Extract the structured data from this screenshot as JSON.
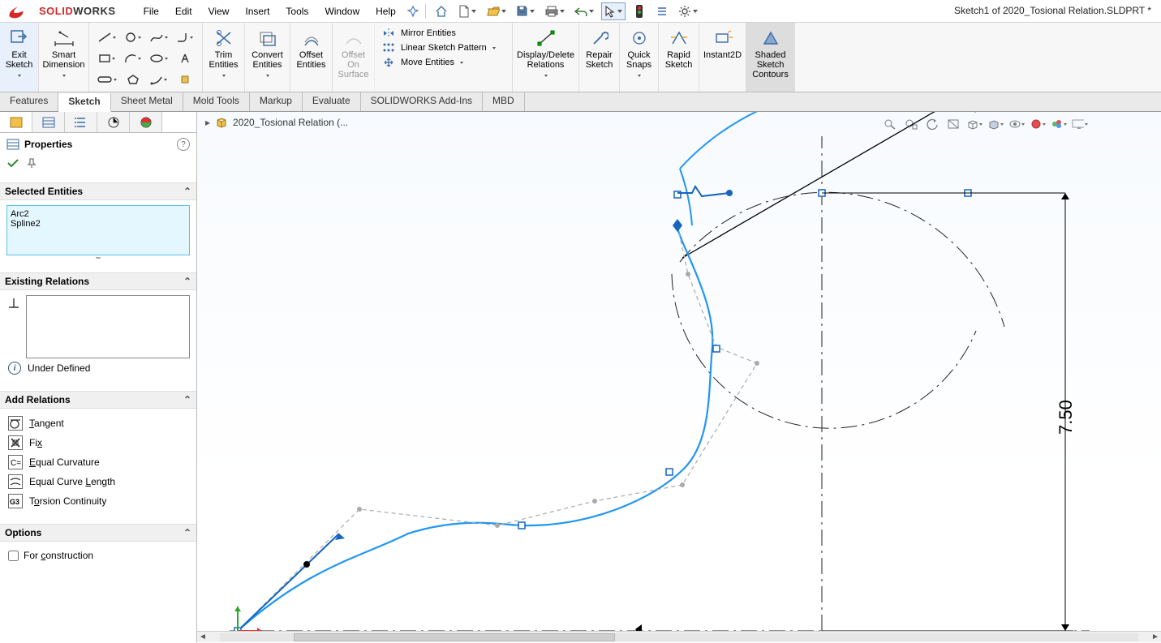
{
  "brand": {
    "s1": "SOLID",
    "s2": "WORKS"
  },
  "doc_title": "Sketch1 of 2020_Tosional Relation.SLDPRT *",
  "menu": [
    "File",
    "Edit",
    "View",
    "Insert",
    "Tools",
    "Window",
    "Help"
  ],
  "ribbon": {
    "exit_sketch": "Exit\nSketch",
    "smart_dim": "Smart\nDimension",
    "trim": "Trim\nEntities",
    "convert": "Convert\nEntities",
    "offset": "Offset\nEntities",
    "offset_surf": "Offset\nOn\nSurface",
    "mirror": "Mirror Entities",
    "linear": "Linear Sketch Pattern",
    "move": "Move Entities",
    "disp_del": "Display/Delete\nRelations",
    "repair": "Repair\nSketch",
    "quick": "Quick\nSnaps",
    "rapid": "Rapid\nSketch",
    "instant": "Instant2D",
    "shaded": "Shaded\nSketch\nContours"
  },
  "tabs": [
    "Features",
    "Sketch",
    "Sheet Metal",
    "Mold Tools",
    "Markup",
    "Evaluate",
    "SOLIDWORKS Add-Ins",
    "MBD"
  ],
  "active_tab": "Sketch",
  "breadcrumb": "2020_Tosional Relation  (...",
  "panel": {
    "title": "Properties",
    "sec_selected": "Selected Entities",
    "selected": [
      "Arc2",
      "Spline2"
    ],
    "sec_existing": "Existing Relations",
    "status": "Under Defined",
    "sec_add": "Add Relations",
    "relations": [
      {
        "icon": "tangent",
        "label_pre": "",
        "key": "T",
        "label_post": "angent"
      },
      {
        "icon": "fix",
        "label_pre": "Fi",
        "key": "x",
        "label_post": ""
      },
      {
        "icon": "eqcurv",
        "label_pre": "",
        "key": "E",
        "label_post": "qual Curvature"
      },
      {
        "icon": "eqlen",
        "label_pre": "Equal Curve ",
        "key": "L",
        "label_post": "ength"
      },
      {
        "icon": "torsion",
        "label_pre": "T",
        "key": "o",
        "label_post": "rsion Continuity"
      }
    ],
    "sec_opts": "Options",
    "construction_pre": "For ",
    "construction_key": "c",
    "construction_post": "onstruction"
  },
  "dimension": "7.50"
}
